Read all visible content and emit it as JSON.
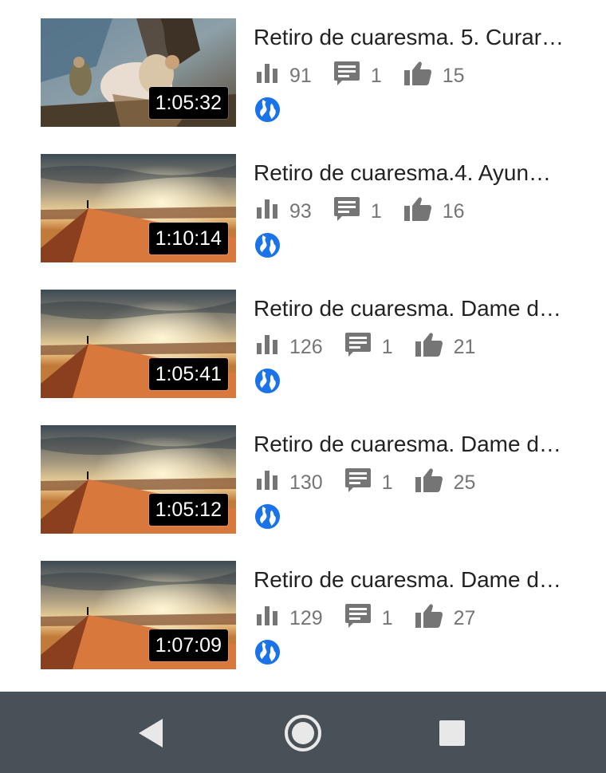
{
  "videos": [
    {
      "title": "Retiro de cuaresma. 5. Curar…",
      "duration": "1:05:32",
      "views": "91",
      "comments": "1",
      "likes": "15",
      "thumbnail": "painting"
    },
    {
      "title": "Retiro de cuaresma.4. Ayun…",
      "duration": "1:10:14",
      "views": "93",
      "comments": "1",
      "likes": "16",
      "thumbnail": "desert-sunset"
    },
    {
      "title": "Retiro de cuaresma. Dame d…",
      "duration": "1:05:41",
      "views": "126",
      "comments": "1",
      "likes": "21",
      "thumbnail": "desert-sunset"
    },
    {
      "title": "Retiro de cuaresma. Dame d…",
      "duration": "1:05:12",
      "views": "130",
      "comments": "1",
      "likes": "25",
      "thumbnail": "desert-sunset"
    },
    {
      "title": "Retiro de cuaresma. Dame d…",
      "duration": "1:07:09",
      "views": "129",
      "comments": "1",
      "likes": "27",
      "thumbnail": "desert-sunset"
    }
  ],
  "icons": {
    "views": "bar-chart-icon",
    "comments": "comment-icon",
    "likes": "thumb-up-icon",
    "visibility": "public-globe-icon"
  },
  "navbar": {
    "back": "back-triangle-icon",
    "home": "home-circle-icon",
    "recents": "recents-square-icon"
  },
  "colors": {
    "stat_text": "#757575",
    "title_text": "#222222",
    "globe": "#1a73e8",
    "navbar_bg": "#485157",
    "duration_bg": "#000000"
  }
}
